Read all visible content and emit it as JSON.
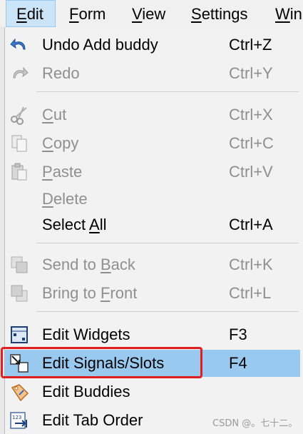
{
  "menubar": {
    "items": [
      {
        "label": "Edit",
        "mnemonic": "E",
        "rest": "dit"
      },
      {
        "label": "Form",
        "mnemonic": "F",
        "rest": "orm"
      },
      {
        "label": "View",
        "mnemonic": "V",
        "rest": "iew"
      },
      {
        "label": "Settings",
        "mnemonic": "S",
        "rest": "ettings"
      },
      {
        "label": "Win",
        "mnemonic": "W",
        "rest": "in"
      }
    ]
  },
  "menu": {
    "undo": {
      "label": "Undo Add buddy",
      "shortcut": "Ctrl+Z",
      "icon": "undo-icon"
    },
    "redo": {
      "label": "Redo",
      "shortcut": "Ctrl+Y",
      "icon": "redo-icon"
    },
    "cut": {
      "pre": "",
      "mn": "C",
      "post": "ut",
      "shortcut": "Ctrl+X",
      "icon": "scissors-icon"
    },
    "copy": {
      "pre": "",
      "mn": "C",
      "post": "opy",
      "shortcut": "Ctrl+C",
      "icon": "copy-icon"
    },
    "paste": {
      "pre": "",
      "mn": "P",
      "post": "aste",
      "shortcut": "Ctrl+V",
      "icon": "paste-icon"
    },
    "delete": {
      "pre": "",
      "mn": "D",
      "post": "elete"
    },
    "select_all": {
      "pre": "Select ",
      "mn": "A",
      "post": "ll",
      "shortcut": "Ctrl+A"
    },
    "send_to_back": {
      "pre": "Send to ",
      "mn": "B",
      "post": "ack",
      "shortcut": "Ctrl+K",
      "icon": "send-to-back-icon"
    },
    "bring_to_front": {
      "pre": "Bring to ",
      "mn": "F",
      "post": "ront",
      "shortcut": "Ctrl+L",
      "icon": "bring-to-front-icon"
    },
    "edit_widgets": {
      "label": "Edit Widgets",
      "shortcut": "F3",
      "icon": "edit-widgets-icon"
    },
    "edit_signals": {
      "label": "Edit Signals/Slots",
      "shortcut": "F4",
      "icon": "edit-signals-icon"
    },
    "edit_buddies": {
      "label": "Edit Buddies",
      "icon": "edit-buddies-icon"
    },
    "edit_tab_order": {
      "label": "Edit Tab Order",
      "icon": "edit-tab-order-icon"
    }
  },
  "watermark": "CSDN @。七十二。",
  "colors": {
    "highlight": "#99c9ef",
    "annotation": "#e02020",
    "disabled": "#8f8f8f"
  }
}
